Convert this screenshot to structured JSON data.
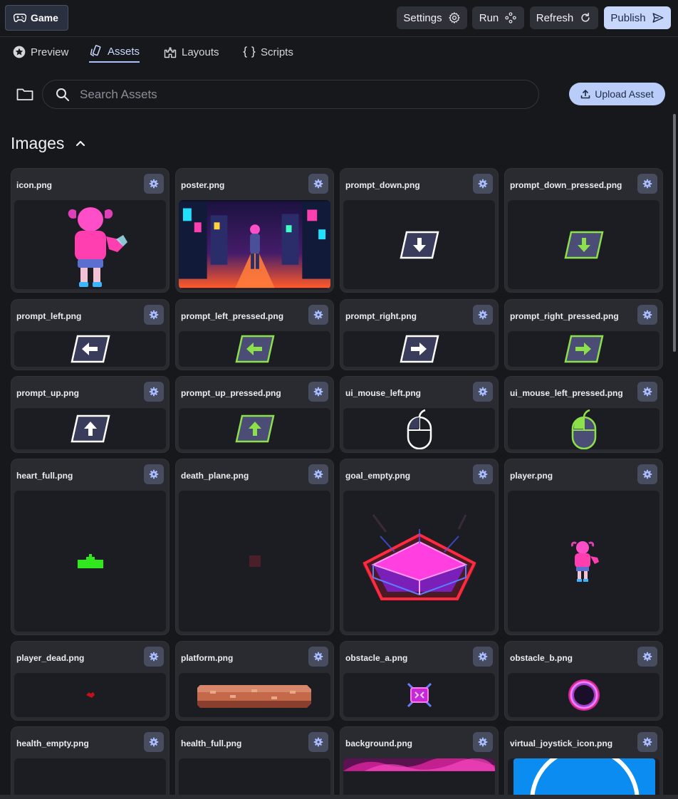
{
  "header": {
    "game_label": "Game",
    "settings_label": "Settings",
    "run_label": "Run",
    "refresh_label": "Refresh",
    "publish_label": "Publish"
  },
  "tabs": [
    {
      "label": "Preview",
      "icon": "star-icon",
      "active": false
    },
    {
      "label": "Assets",
      "icon": "assets-icon",
      "active": true
    },
    {
      "label": "Layouts",
      "icon": "castle-icon",
      "active": false
    },
    {
      "label": "Scripts",
      "icon": "braces-icon",
      "active": false
    }
  ],
  "search": {
    "placeholder": "Search Assets",
    "value": ""
  },
  "upload_label": "Upload Asset",
  "section": {
    "title": "Images",
    "expanded": true
  },
  "assets": [
    {
      "name": "icon.png"
    },
    {
      "name": "poster.png"
    },
    {
      "name": "prompt_down.png"
    },
    {
      "name": "prompt_down_pressed.png"
    },
    {
      "name": "prompt_left.png"
    },
    {
      "name": "prompt_left_pressed.png"
    },
    {
      "name": "prompt_right.png"
    },
    {
      "name": "prompt_right_pressed.png"
    },
    {
      "name": "prompt_up.png"
    },
    {
      "name": "prompt_up_pressed.png"
    },
    {
      "name": "ui_mouse_left.png"
    },
    {
      "name": "ui_mouse_left_pressed.png"
    },
    {
      "name": "heart_full.png"
    },
    {
      "name": "death_plane.png"
    },
    {
      "name": "goal_empty.png"
    },
    {
      "name": "player.png"
    },
    {
      "name": "player_dead.png"
    },
    {
      "name": "platform.png"
    },
    {
      "name": "obstacle_a.png"
    },
    {
      "name": "obstacle_b.png"
    },
    {
      "name": "health_empty.png"
    },
    {
      "name": "health_full.png"
    },
    {
      "name": "background.png"
    },
    {
      "name": "virtual_joystick_icon.png"
    }
  ],
  "colors": {
    "accent": "#c7d7fb",
    "card_bg": "#2a2b31",
    "page_bg": "#17181c"
  }
}
